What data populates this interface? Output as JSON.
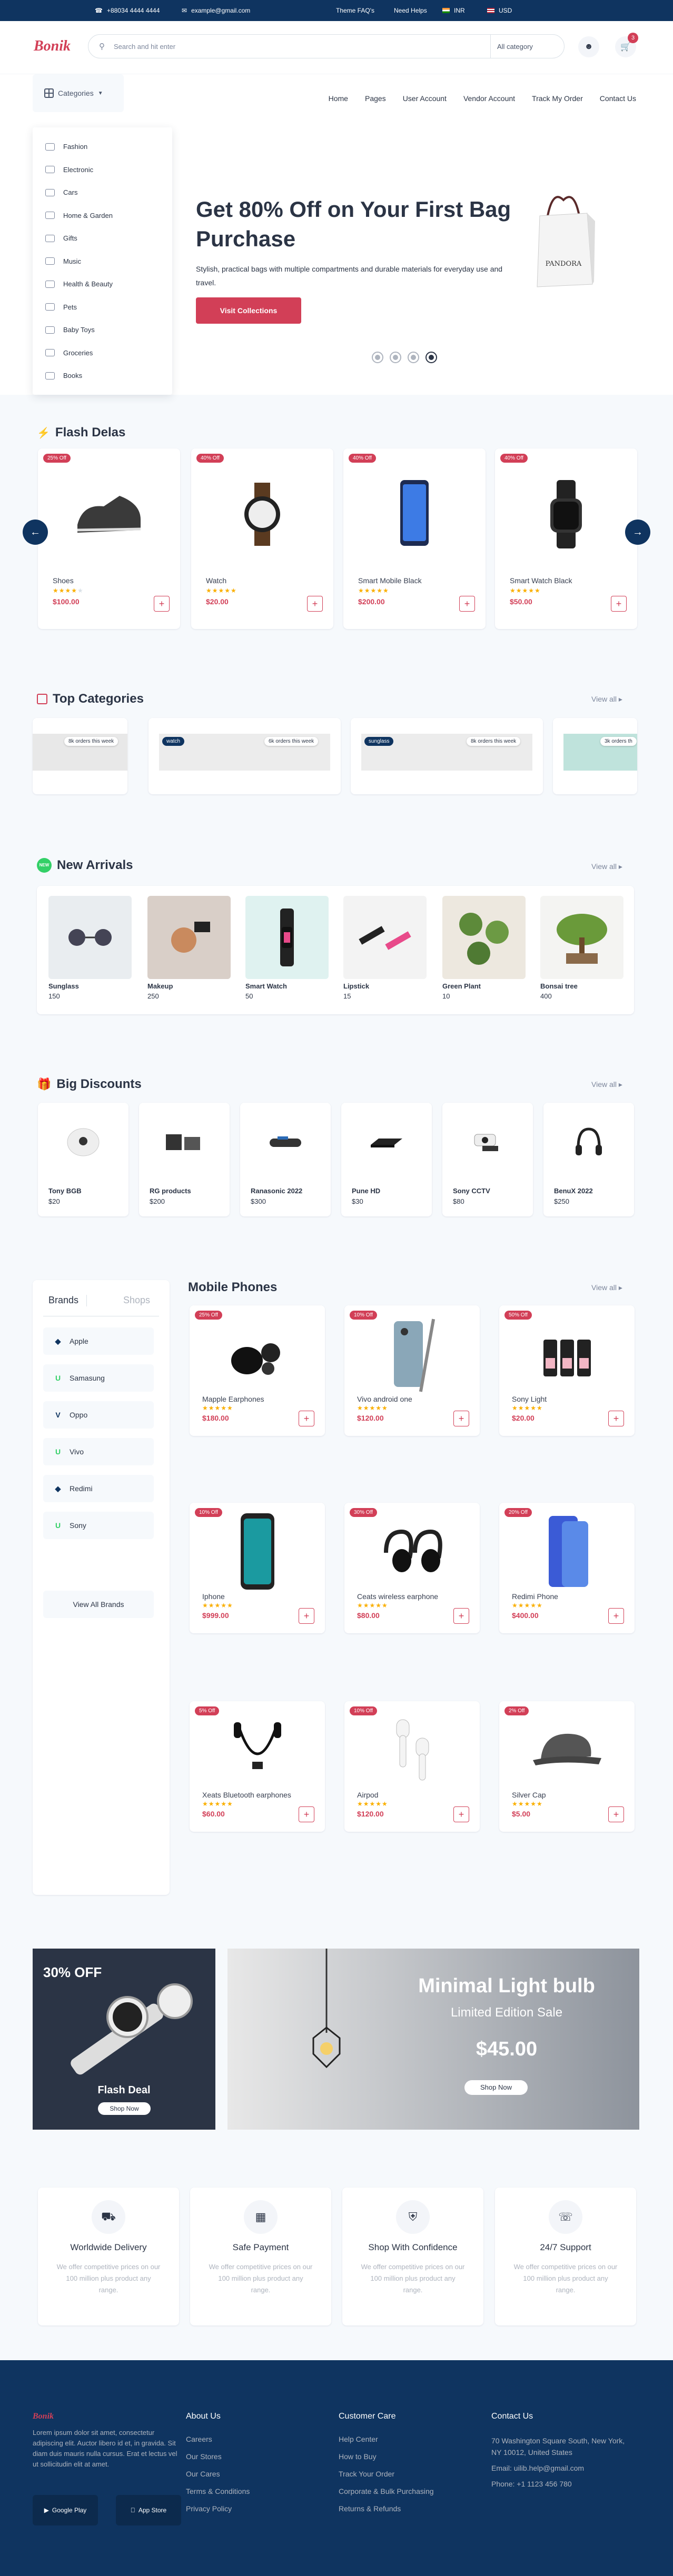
{
  "topbar": {
    "phone": "+88034 4444 4444",
    "email": "example@gmail.com",
    "faq": "Theme FAQ's",
    "help": "Need Helps",
    "lang": "INR",
    "currency": "USD"
  },
  "header": {
    "logo": "Bonik",
    "search_placeholder": "Search and hit enter",
    "search_category": "All category",
    "cart_count": "3"
  },
  "nav": {
    "categories_label": "Categories",
    "links": [
      "Home",
      "Pages",
      "User Account",
      "Vendor Account",
      "Track My Order",
      "Contact Us"
    ]
  },
  "categories": [
    "Fashion",
    "Electronic",
    "Cars",
    "Home & Garden",
    "Gifts",
    "Music",
    "Health & Beauty",
    "Pets",
    "Baby Toys",
    "Groceries",
    "Books"
  ],
  "hero": {
    "title": "Get 80% Off on Your First Bag Purchase",
    "description": "Stylish, practical bags with multiple compartments and durable materials for everyday use and travel.",
    "button": "Visit Collections",
    "brand_on_bag": "PANDORA"
  },
  "flash": {
    "title": "Flash Delas",
    "products": [
      {
        "badge": "25% Off",
        "name": "Shoes",
        "price": "$100.00",
        "rating": 4
      },
      {
        "badge": "40% Off",
        "name": "Watch",
        "price": "$20.00",
        "rating": 4
      },
      {
        "badge": "40% Off",
        "name": "Smart Mobile Black",
        "price": "$200.00",
        "rating": 4
      },
      {
        "badge": "40% Off",
        "name": "Smart Watch Black",
        "price": "$50.00",
        "rating": 4
      }
    ]
  },
  "topcat": {
    "title": "Top Categories",
    "view_all": "View all",
    "cards": [
      {
        "tag": "",
        "orders": "8k orders this week"
      },
      {
        "tag": "watch",
        "orders": "6k orders this week"
      },
      {
        "tag": "sunglass",
        "orders": "8k orders this week"
      },
      {
        "tag": "",
        "orders": "3k orders th"
      }
    ]
  },
  "arrivals": {
    "title": "New Arrivals",
    "view_all": "View all",
    "badge": "NEW",
    "items": [
      {
        "name": "Sunglass",
        "value": "150"
      },
      {
        "name": "Makeup",
        "value": "250"
      },
      {
        "name": "Smart Watch",
        "value": "50"
      },
      {
        "name": "Lipstick",
        "value": "15"
      },
      {
        "name": "Green Plant",
        "value": "10"
      },
      {
        "name": "Bonsai tree",
        "value": "400"
      }
    ]
  },
  "discounts": {
    "title": "Big Discounts",
    "view_all": "View all",
    "items": [
      {
        "name": "Tony BGB",
        "price": "$20"
      },
      {
        "name": "RG products",
        "price": "$200"
      },
      {
        "name": "Ranasonic 2022",
        "price": "$300"
      },
      {
        "name": "Pune HD",
        "price": "$30"
      },
      {
        "name": "Sony CCTV",
        "price": "$80"
      },
      {
        "name": "BenuX 2022",
        "price": "$250"
      }
    ]
  },
  "brands": {
    "tab_brands": "Brands",
    "tab_shops": "Shops",
    "items": [
      "Apple",
      "Samasung",
      "Oppo",
      "Vivo",
      "Redimi",
      "Sony"
    ],
    "button": "View All Brands"
  },
  "phones": {
    "title": "Mobile Phones",
    "view_all": "View all",
    "products": [
      {
        "badge": "25% Off",
        "name": "Mapple Earphones",
        "price": "$180.00"
      },
      {
        "badge": "10% Off",
        "name": "Vivo android one",
        "price": "$120.00"
      },
      {
        "badge": "50% Off",
        "name": "Sony Light",
        "price": "$20.00"
      },
      {
        "badge": "10% Off",
        "name": "Iphone",
        "price": "$999.00"
      },
      {
        "badge": "30% Off",
        "name": "Ceats wireless earphone",
        "price": "$80.00"
      },
      {
        "badge": "20% Off",
        "name": "Redimi Phone",
        "price": "$400.00"
      },
      {
        "badge": "5% Off",
        "name": "Xeats Bluetooth earphones",
        "price": "$60.00"
      },
      {
        "badge": "10% Off",
        "name": "Airpod",
        "price": "$120.00"
      },
      {
        "badge": "2% Off",
        "name": "Silver Cap",
        "price": "$5.00"
      }
    ]
  },
  "promo": {
    "left_off": "30% OFF",
    "left_title": "Flash Deal",
    "left_btn": "Shop Now",
    "right_title": "Minimal  Light bulb",
    "right_sub": "Limited Edition Sale",
    "right_price": "$45.00",
    "right_btn": "Shop Now"
  },
  "services": [
    {
      "title": "Worldwide Delivery",
      "text": "We offer competitive prices on our 100 million plus product any range."
    },
    {
      "title": "Safe Payment",
      "text": "We offer competitive prices on our 100 million plus product any range."
    },
    {
      "title": "Shop With Confidence",
      "text": "We offer competitive prices on our 100 million plus product any range."
    },
    {
      "title": "24/7 Support",
      "text": "We offer competitive prices on our 100 million plus product any range."
    }
  ],
  "footer": {
    "logo": "Bonik",
    "about": "Lorem ipsum dolor sit amet, consectetur adipiscing elit. Auctor libero id et, in gravida. Sit diam duis mauris nulla cursus. Erat et lectus vel ut sollicitudin elit at amet.",
    "google": "Google Play",
    "appstore": "App Store",
    "col1_title": "About Us",
    "col1": [
      "Careers",
      "Our Stores",
      "Our Cares",
      "Terms & Conditions",
      "Privacy Policy"
    ],
    "col2_title": "Customer Care",
    "col2": [
      "Help Center",
      "How to Buy",
      "Track Your Order",
      "Corporate & Bulk Purchasing",
      "Returns & Refunds"
    ],
    "col3_title": "Contact Us",
    "address": "70 Washington Square South, New York, NY 10012, United States",
    "email": "Email: uilib.help@gmail.com",
    "phone": "Phone: +1 1123 456 780"
  },
  "colors": {
    "primary": "#d23f57",
    "navy": "#0f3460",
    "star": "#faaf00"
  }
}
